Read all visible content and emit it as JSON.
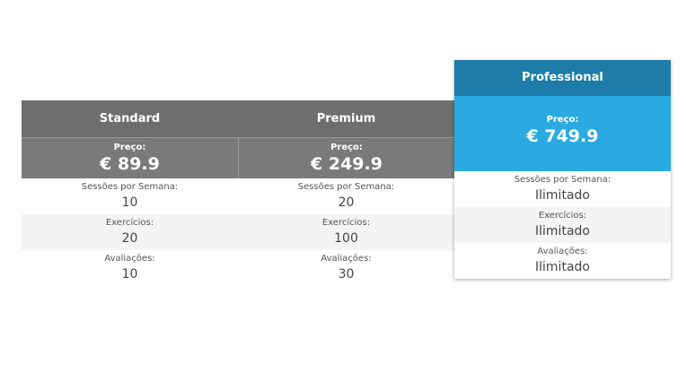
{
  "plans": [
    {
      "name": "Standard",
      "price_label": "Preço:",
      "price": "€ 89.9",
      "features": [
        {
          "label": "Sessões por Semana:",
          "value": "10"
        },
        {
          "label": "Exercícios:",
          "value": "20"
        },
        {
          "label": "Avaliações:",
          "value": "10"
        }
      ]
    },
    {
      "name": "Premium",
      "price_label": "Preço:",
      "price": "€ 249.9",
      "features": [
        {
          "label": "Sessões por Semana:",
          "value": "20"
        },
        {
          "label": "Exercícios:",
          "value": "100"
        },
        {
          "label": "Avaliações:",
          "value": "30"
        }
      ]
    },
    {
      "name": "Professional",
      "price_label": "Preço:",
      "price": "€ 749.9",
      "features": [
        {
          "label": "Sessões por Semana:",
          "value": "Ilimitado"
        },
        {
          "label": "Exercícios:",
          "value": "Ilimitado"
        },
        {
          "label": "Avaliações:",
          "value": "Ilimitado"
        }
      ]
    }
  ],
  "colors": {
    "standard_header": "#6e6e6e",
    "standard_price": "#7a7a7a",
    "featured_header": "#1e7ca8",
    "featured_price": "#29aae1",
    "alt_row": "#f4f4f4"
  }
}
